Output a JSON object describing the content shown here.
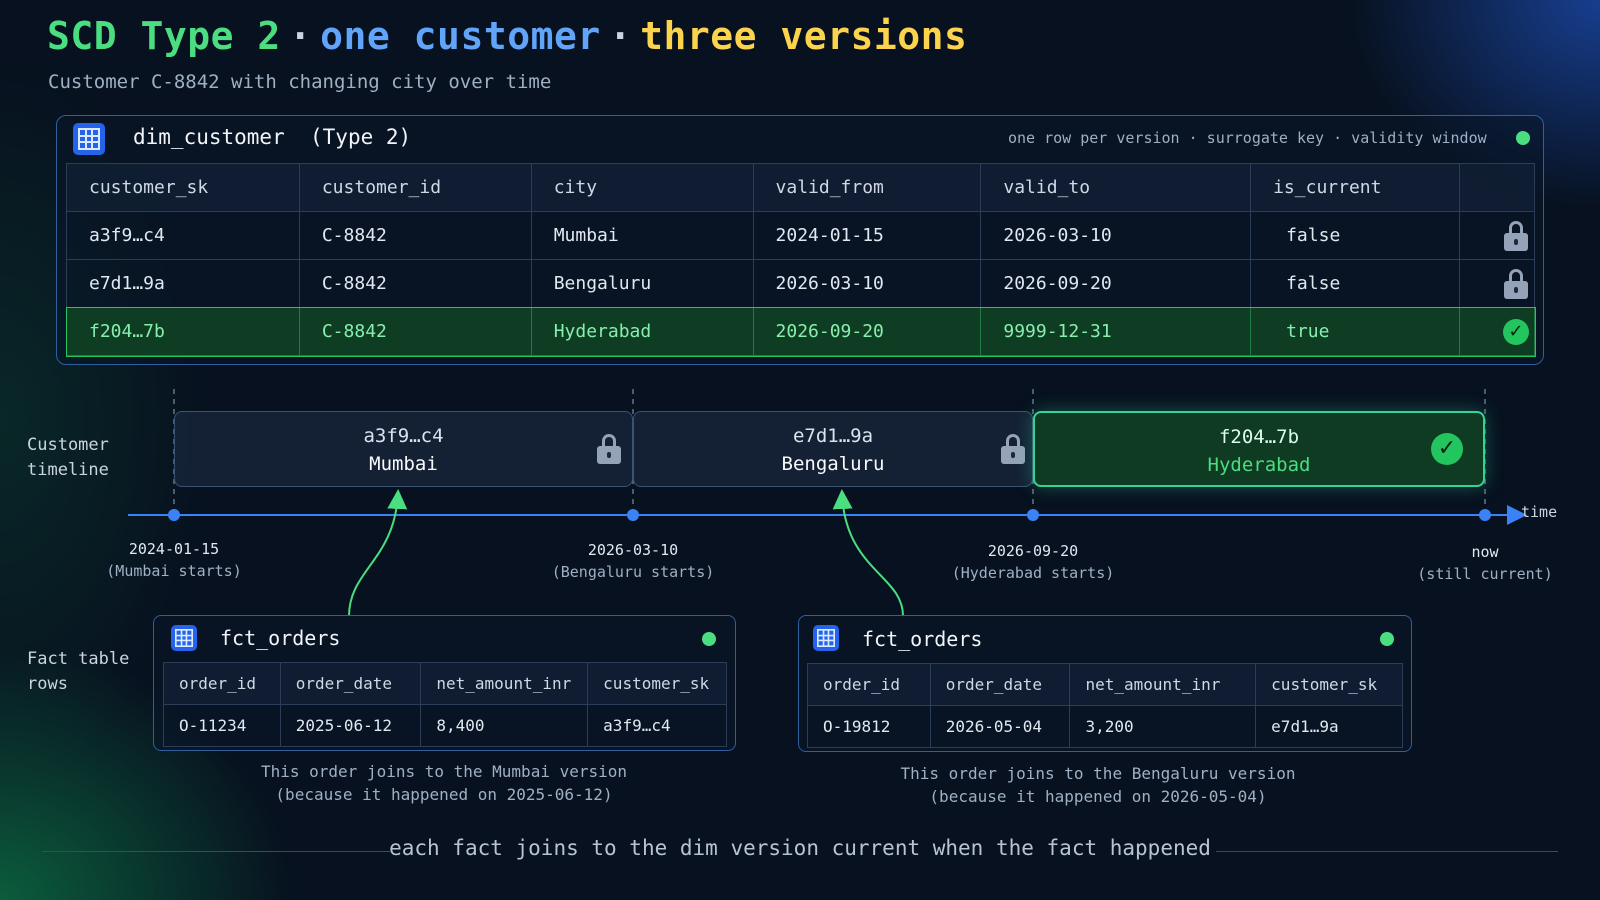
{
  "title": {
    "part1": "SCD Type 2",
    "sep": "·",
    "part2": "one customer",
    "part3": "three versions"
  },
  "subtitle": "Customer C-8842 with changing city over time",
  "dim": {
    "name": "dim_customer",
    "type_label": "(Type 2)",
    "note": "one row per version · surrogate key · validity window",
    "columns": [
      "customer_sk",
      "customer_id",
      "city",
      "valid_from",
      "valid_to",
      "is_current"
    ],
    "rows": [
      {
        "customer_sk": "a3f9…c4",
        "customer_id": "C-8842",
        "city": "Mumbai",
        "valid_from": "2024-01-15",
        "valid_to": "2026-03-10",
        "is_current": "false",
        "status_icon": "lock-icon"
      },
      {
        "customer_sk": "e7d1…9a",
        "customer_id": "C-8842",
        "city": "Bengaluru",
        "valid_from": "2026-03-10",
        "valid_to": "2026-09-20",
        "is_current": "false",
        "status_icon": "lock-icon"
      },
      {
        "customer_sk": "f204…7b",
        "customer_id": "C-8842",
        "city": "Hyderabad",
        "valid_from": "2026-09-20",
        "valid_to": "9999-12-31",
        "is_current": "true",
        "status_icon": "check-icon"
      }
    ]
  },
  "timeline": {
    "label_line1": "Customer",
    "label_line2": "timeline",
    "axis_label": "time",
    "versions": [
      {
        "sk": "a3f9…c4",
        "city": "Mumbai",
        "icon": "lock-icon"
      },
      {
        "sk": "e7d1…9a",
        "city": "Bengaluru",
        "icon": "lock-icon"
      },
      {
        "sk": "f204…7b",
        "city": "Hyderabad",
        "icon": "check-icon"
      }
    ],
    "ticks": [
      {
        "date": "2024-01-15",
        "note": "(Mumbai starts)"
      },
      {
        "date": "2026-03-10",
        "note": "(Bengaluru starts)"
      },
      {
        "date": "2026-09-20",
        "note": "(Hyderabad starts)"
      },
      {
        "date": "now",
        "note": "(still current)"
      }
    ]
  },
  "facts": {
    "label_line1": "Fact table",
    "label_line2": "rows",
    "tables": [
      {
        "name": "fct_orders",
        "columns": [
          "order_id",
          "order_date",
          "net_amount_inr",
          "customer_sk"
        ],
        "row": [
          "O-11234",
          "2025-06-12",
          "8,400",
          "a3f9…c4"
        ],
        "caption_line1": "This order joins to the Mumbai version",
        "caption_line2": "(because it happened on 2025-06-12)"
      },
      {
        "name": "fct_orders",
        "columns": [
          "order_id",
          "order_date",
          "net_amount_inr",
          "customer_sk"
        ],
        "row": [
          "O-19812",
          "2026-05-04",
          "3,200",
          "e7d1…9a"
        ],
        "caption_line1": "This order joins to the Bengaluru version",
        "caption_line2": "(because it happened on 2026-05-04)"
      }
    ]
  },
  "footer": "each fact joins to the dim version current when the fact happened",
  "colors": {
    "green": "#4ade80",
    "blue": "#60a5fa",
    "yellow": "#fcd34d",
    "axis": "#3b82f6"
  }
}
